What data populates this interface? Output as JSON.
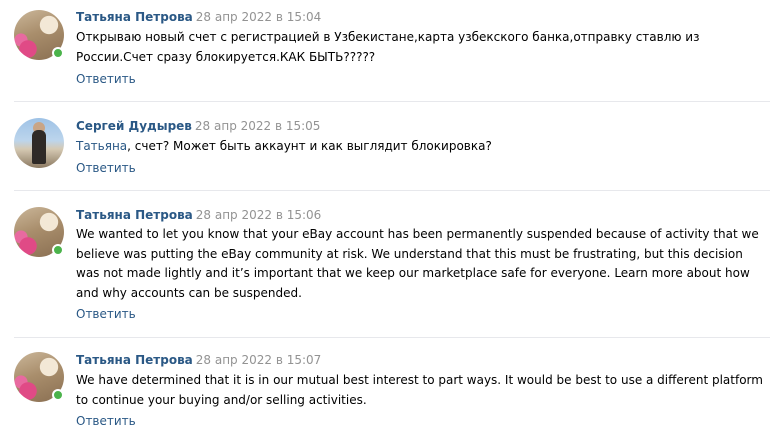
{
  "accent_link_color": "#2a5885",
  "date_color": "#939393",
  "online_color": "#4bb34b",
  "comments": [
    {
      "author": "Татьяна Петрова",
      "date": "28 апр 2022 в 15:04",
      "text": "Открываю новый счет с регистрацией в Узбекистане,карта узбекского банка,отправку ставлю из России.Счет сразу блокируется.КАК БЫТЬ?????",
      "reply_label": "Ответить",
      "avatar_icon": "avatar-photo-woman-with-flowers",
      "online": true
    },
    {
      "author": "Сергей Дудырев",
      "date": "28 апр 2022 в 15:05",
      "mention": "Татьяна",
      "text": ", счет? Может быть аккаунт и как выглядит блокировка?",
      "reply_label": "Ответить",
      "avatar_icon": "avatar-photo-man-outdoors",
      "online": false
    },
    {
      "author": "Татьяна Петрова",
      "date": "28 апр 2022 в 15:06",
      "text": "We wanted to let you know that your eBay account has been permanently suspended because of activity that we believe was putting the eBay community at risk. We understand that this must be frustrating, but this decision was not made lightly and it’s important that we keep our marketplace safe for everyone. Learn more about how and why accounts can be suspended.",
      "reply_label": "Ответить",
      "avatar_icon": "avatar-photo-woman-with-flowers",
      "online": true
    },
    {
      "author": "Татьяна Петрова",
      "date": "28 апр 2022 в 15:07",
      "text": "We have determined that it is in our mutual best interest to part ways. It would be best to use a different platform to continue your buying and/or selling activities.",
      "reply_label": "Ответить",
      "avatar_icon": "avatar-photo-woman-with-flowers",
      "online": true
    }
  ]
}
